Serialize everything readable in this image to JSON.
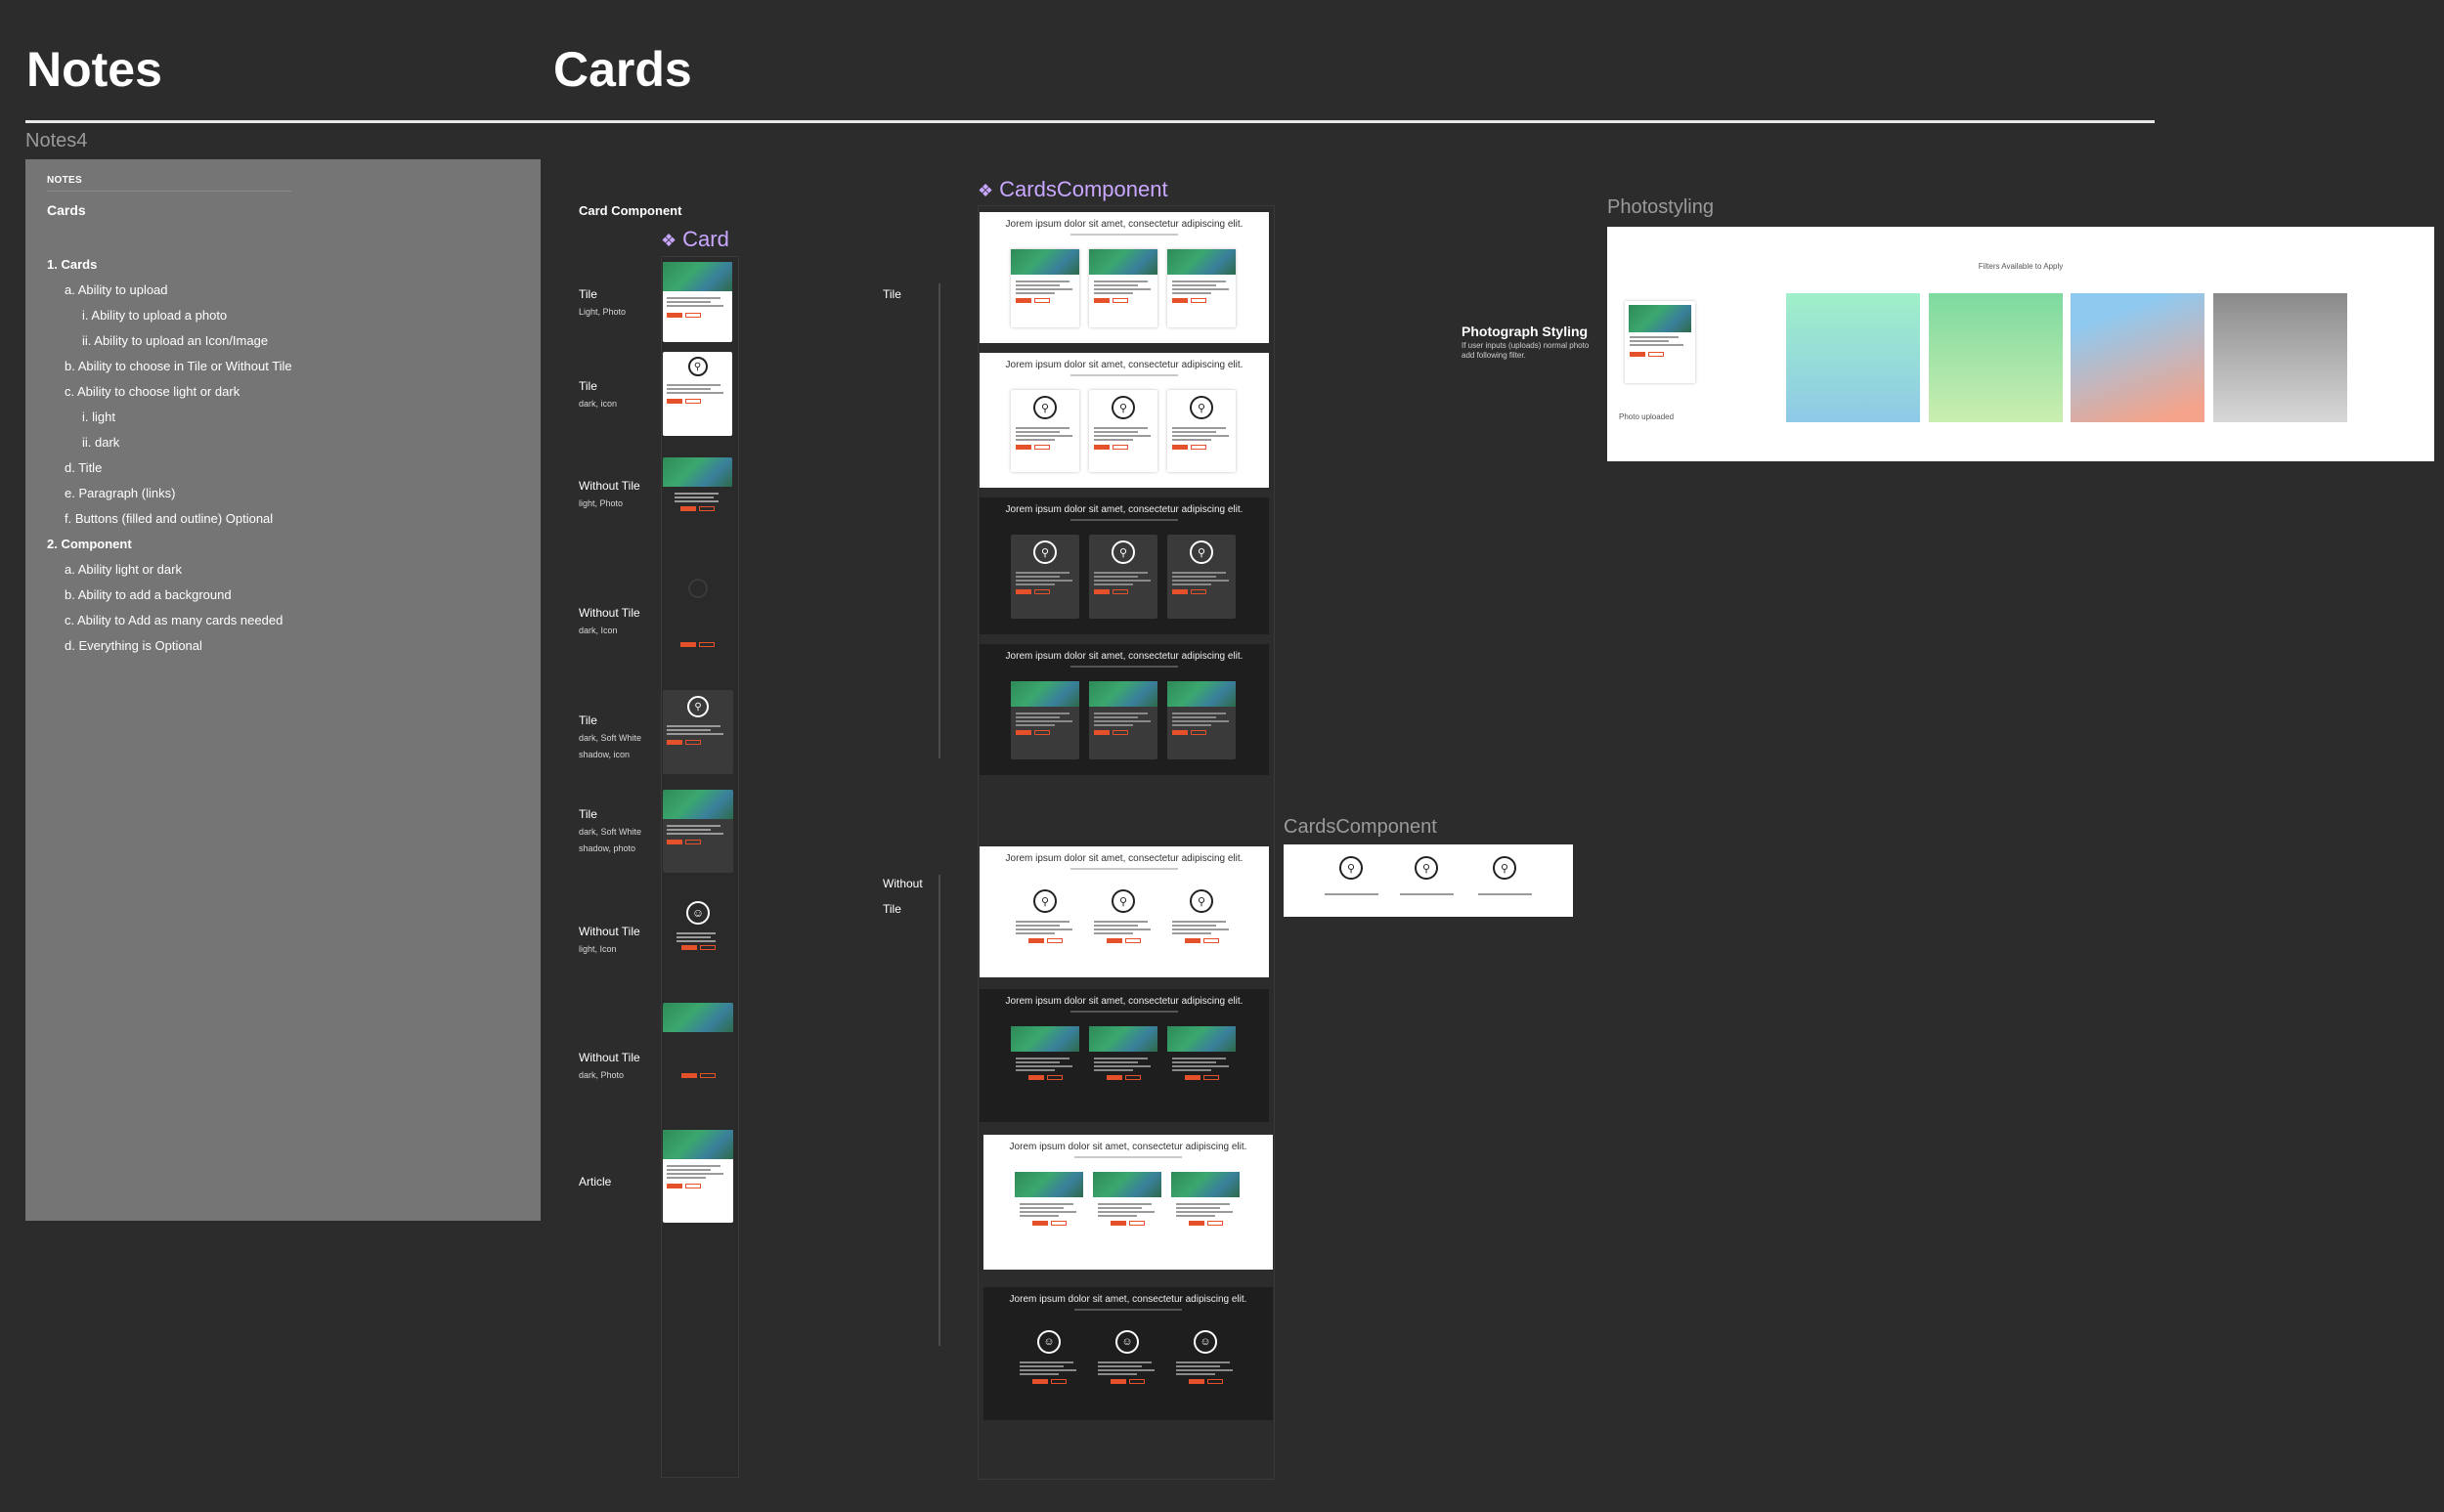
{
  "headers": {
    "notes": "Notes",
    "cards": "Cards"
  },
  "notes_frame": {
    "label": "Notes4",
    "section": "NOTES",
    "title": "Cards",
    "items": [
      {
        "text": "1. Cards",
        "level": 0
      },
      {
        "text": "a. Ability to upload",
        "level": 1
      },
      {
        "text": "i. Ability to upload a photo",
        "level": 2
      },
      {
        "text": "ii. Ability to upload an Icon/Image",
        "level": 2
      },
      {
        "text": "b. Ability to choose in Tile or Without Tile",
        "level": 1
      },
      {
        "text": "c. Ability to choose light or dark",
        "level": 1
      },
      {
        "text": "i. light",
        "level": 2
      },
      {
        "text": "ii. dark",
        "level": 2
      },
      {
        "text": "d. Title",
        "level": 1
      },
      {
        "text": "e. Paragraph (links)",
        "level": 1
      },
      {
        "text": "f. Buttons (filled and outline) Optional",
        "level": 1
      },
      {
        "text": "2. Component",
        "level": 0
      },
      {
        "text": "a. Ability light or dark",
        "level": 1
      },
      {
        "text": "b. Ability to add a background",
        "level": 1
      },
      {
        "text": "c. Ability to Add as many cards needed",
        "level": 1
      },
      {
        "text": "d. Everything is Optional",
        "level": 1
      }
    ]
  },
  "card_component": {
    "label": "Card Component",
    "component_title": "Card",
    "variants": [
      {
        "title": "Tile",
        "sub": "Light, Photo"
      },
      {
        "title": "Tile",
        "sub": "dark, icon"
      },
      {
        "title": "Without Tile",
        "sub": "light, Photo"
      },
      {
        "title": "Without Tile",
        "sub": "dark, Icon"
      },
      {
        "title": "Tile",
        "sub": "dark, Soft White",
        "sub2": "shadow, icon"
      },
      {
        "title": "Tile",
        "sub": "dark, Soft White",
        "sub2": "shadow, photo"
      },
      {
        "title": "Without Tile",
        "sub": "light, Icon"
      },
      {
        "title": "Without Tile",
        "sub": "dark, Photo"
      },
      {
        "title": "Article",
        "sub": ""
      }
    ]
  },
  "cards_component": {
    "title": "CardsComponent",
    "group_tile": "Tile",
    "group_without_1": "Without",
    "group_without_2": "Tile",
    "row_heading": "Jorem ipsum dolor sit amet, consectetur adipiscing elit."
  },
  "cards_component_2": {
    "label": "CardsComponent"
  },
  "photostyling": {
    "label": "Photostyling",
    "filters_heading": "Filters Available to Apply",
    "photo_caption": "Photo uploaded",
    "side_title": "Photograph Styling",
    "side_sub_1": "If user inputs (uploads) normal photo",
    "side_sub_2": "add following filter.",
    "swatches": [
      "#9fe6c8",
      "#7fd8a0",
      "#f5a38a",
      "#8e8e8e"
    ]
  }
}
